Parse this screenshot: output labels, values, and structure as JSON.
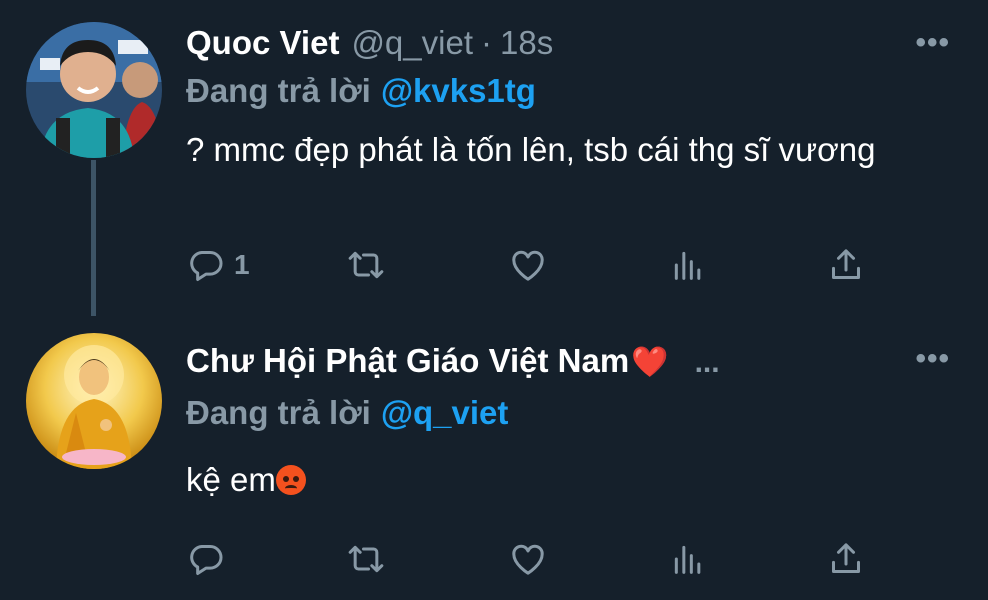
{
  "tweets": [
    {
      "display_name": "Quoc Viet",
      "handle": "@q_viet",
      "separator": "·",
      "time": "18s",
      "replying_label": "Đang trả lời",
      "replying_to": "@kvks1tg",
      "text": "? mmc đẹp phát là tốn lên, tsb cái thg sĩ vương",
      "reply_count": "1",
      "more": "•••"
    },
    {
      "display_name": "Chư Hội Phật Giáo Việt Nam",
      "name_emoji": "❤️",
      "name_trail": "...",
      "replying_label": "Đang trả lời",
      "replying_to": "@q_viet",
      "text": "kệ em",
      "text_emoji": "angry-face-emoji",
      "reply_count": "",
      "more": "•••"
    }
  ],
  "colors": {
    "background": "#15202b",
    "secondary_text": "#8899a6",
    "accent": "#1da1f2",
    "thread_line": "#3d5466"
  },
  "icons": [
    "reply-icon",
    "retweet-icon",
    "like-icon",
    "analytics-icon",
    "share-icon"
  ]
}
